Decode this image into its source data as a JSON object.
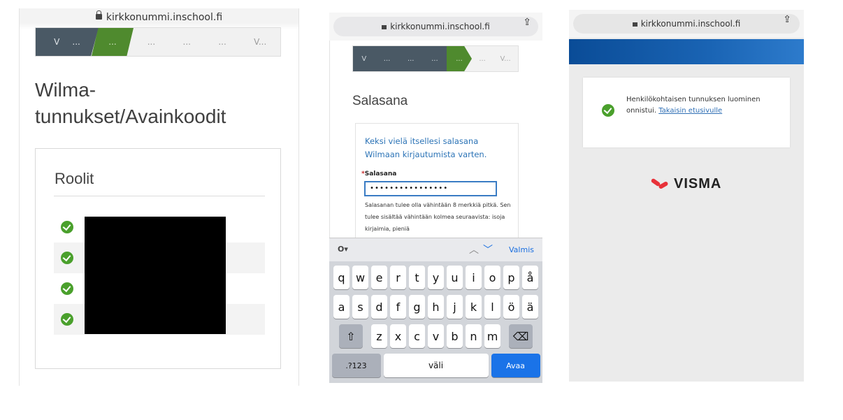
{
  "panel1": {
    "url": "kirkkonummi.inschool.fi",
    "steps": {
      "first": "V",
      "dark": "...",
      "green": "...",
      "light": [
        "...",
        "...",
        "..."
      ],
      "last": "V..."
    },
    "title": "Wilma-tunnukset/Avainkoodit",
    "roles_heading": "Roolit",
    "roles_count": 4
  },
  "panel2": {
    "url": "kirkkonummi.inschool.fi",
    "steps": {
      "first": "V",
      "dark": [
        "...",
        "...",
        "..."
      ],
      "green": "...",
      "light": [
        "...",
        "V..."
      ]
    },
    "title": "Salasana",
    "intro": "Keksi vielä itsellesi salasana Wilmaan kirjautumista varten.",
    "password_label": "Salasana",
    "password_value": "••••••••••••••••",
    "help_text": "Salasanan tulee olla vähintään 8 merkkiä pitkä. Sen tulee sisältää vähintään kolmea seuraavista: isoja kirjaimia, pieniä",
    "toolbar": {
      "key": "O▾",
      "done": "Valmis"
    },
    "keyboard": {
      "row1": [
        "q",
        "w",
        "e",
        "r",
        "t",
        "y",
        "u",
        "i",
        "o",
        "p",
        "å"
      ],
      "row2": [
        "a",
        "s",
        "d",
        "f",
        "g",
        "h",
        "j",
        "k",
        "l",
        "ö",
        "ä"
      ],
      "row3": [
        "z",
        "x",
        "c",
        "v",
        "b",
        "n",
        "m"
      ],
      "shift": "⇧",
      "backspace": "⌫",
      "numbers": ".?123",
      "space": "väli",
      "go": "Avaa"
    }
  },
  "panel3": {
    "url": "kirkkonummi.inschool.fi",
    "message": "Henkilökohtaisen tunnuksen luominen onnistui.",
    "link": "Takaisin etusivulle",
    "logo": "VISMA"
  },
  "colors": {
    "dark_step": "#4a5965",
    "green_step": "#4f8a2e",
    "check": "#4aa02c",
    "link": "#2b73b6",
    "banner": "#0a4c97",
    "go_key": "#1a73e8",
    "visma_red": "#e8323a"
  }
}
